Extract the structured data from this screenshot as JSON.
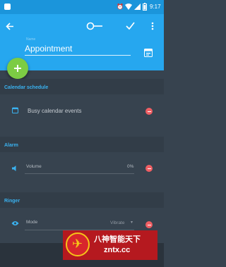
{
  "status_bar": {
    "time": "9:17"
  },
  "header": {
    "title_value": "Appointment",
    "name_hint": "Name"
  },
  "fab": {
    "icon": "plus-icon"
  },
  "sections": {
    "calendar": {
      "title": "Calendar schedule",
      "row_label": "Busy calendar events"
    },
    "alarm": {
      "title": "Alarm",
      "volume_label": "Volume",
      "volume_value": "0%"
    },
    "ringer": {
      "title": "Ringer",
      "mode_label": "Mode",
      "mode_value": "Vibrate"
    }
  },
  "watermark": {
    "text": "八神智能天下",
    "url": "zntx.cc"
  },
  "colors": {
    "app_bar": "#26a7ef",
    "status_bar": "#1b95db",
    "fab": "#7ccc44",
    "accent": "#3ab2f0",
    "remove": "#ef5e63"
  }
}
